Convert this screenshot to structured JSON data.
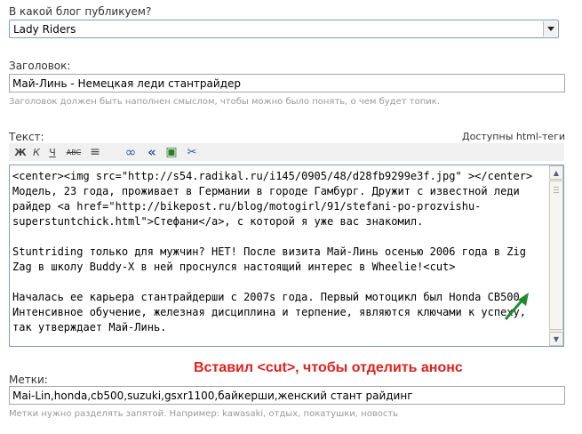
{
  "blog": {
    "label": "В какой блог публикуем?",
    "selected": "Lady Riders"
  },
  "title": {
    "label": "Заголовок:",
    "value": "Май-Линь - Немецкая леди стантрайдер",
    "hint": "Заголовок должен быть наполнен смыслом, чтобы можно было понять, о чем будет топик."
  },
  "text": {
    "label": "Текст:",
    "html_tags_link": "Доступны html-теги",
    "toolbar": {
      "bold": "Ж",
      "italic": "К",
      "underline": "Ч",
      "strike": "ABC",
      "list": "≡",
      "link": "∞",
      "quote": "«",
      "video": "▣",
      "cut": "✂"
    },
    "content": "<center><img src=\"http://s54.radikal.ru/i145/0905/48/d28fb9299e3f.jpg\" ></center>\nМодель, 23 года, проживает в Германии в городе Гамбург. Дружит с известной леди райдер <a href=\"http://bikepost.ru/blog/motogirl/91/stefani-po-prozvishu-superstuntchick.html\">Стефани</a>, с которой я уже вас знакомил.\n\nStuntriding только для мужчин? НЕТ! После визита Май-Линь осенью 2006 года в Zig Zag в школу Buddy-X в ней проснулся настоящий интерес в Wheelie!<cut>\n\nНачалась ее карьера стантрайдерши с 2007s года. Первый мотоцикл был Honda CB500.\nИнтенсивное обучение, железная дисциплина и терпение, являются ключами к успеху, так утверждает Май-Линь."
  },
  "annotation": "Вставил <cut>, чтобы отделить анонс",
  "tags": {
    "label": "Метки:",
    "value": "Mai-Lin,honda,cb500,suzuki,gsxr1100,байкерши,женский стант райдинг",
    "hint": "Метки нужно разделять запятой. Например: kawasaki, отдых, покатушки, новость"
  },
  "colors": {
    "annotation": "#e0201c",
    "arrow": "#1f8a2e",
    "border": "#7f9db9"
  }
}
